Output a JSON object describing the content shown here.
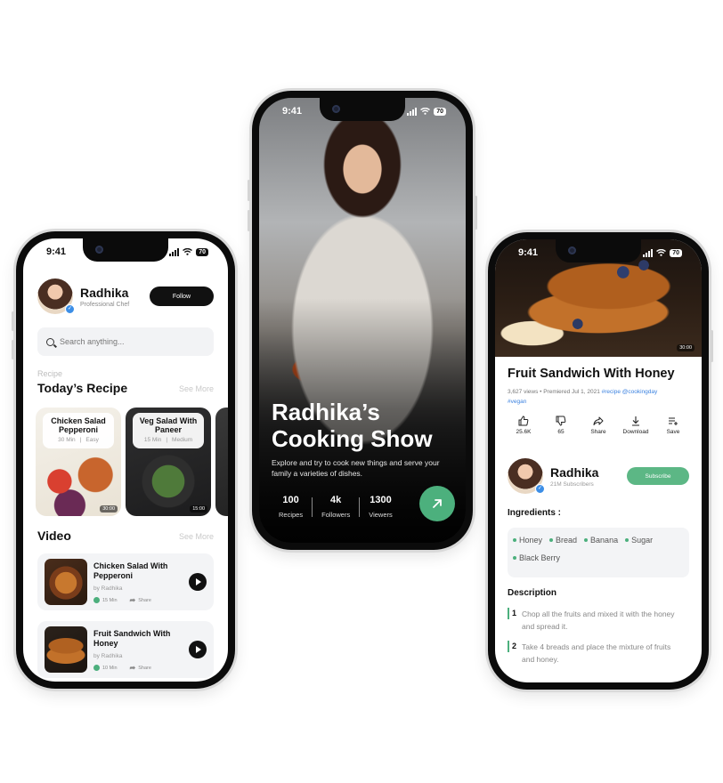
{
  "status": {
    "time": "9:41",
    "battery": "70"
  },
  "profile_screen": {
    "name": "Radhika",
    "role": "Professional Chef",
    "follow_label": "Follow",
    "search_placeholder": "Search anything...",
    "recipe_small_label": "Recipe",
    "recipes_title": "Today’s Recipe",
    "see_more": "See More",
    "recipes": [
      {
        "title": "Chicken Salad Pepperoni",
        "time": "30 Min",
        "level": "Easy",
        "duration": "30:00"
      },
      {
        "title": "Veg Salad With Paneer",
        "time": "15 Min",
        "level": "Medium",
        "duration": "15:00"
      }
    ],
    "video_title": "Video",
    "videos": [
      {
        "title": "Chicken Salad With Pepperoni",
        "by": "by Radhika",
        "time": "15 Min",
        "share": "Share"
      },
      {
        "title": "Fruit Sandwich With Honey",
        "by": "by Radhika",
        "time": "10 Min",
        "share": "Share"
      }
    ]
  },
  "show_screen": {
    "title_line1": "Radhika’s",
    "title_line2": "Cooking Show",
    "description": "Explore and try to cook new things and serve your family a varieties of dishes.",
    "stats": [
      {
        "value": "100",
        "label": "Recipes"
      },
      {
        "value": "4k",
        "label": "Followers"
      },
      {
        "value": "1300",
        "label": "Viewers"
      }
    ]
  },
  "detail_screen": {
    "video_duration": "30:00",
    "title": "Fruit Sandwich With Honey",
    "views_text": "3,627 views • Premiered Jul 1, 2021",
    "tags": "#recipe @cookingday",
    "tags2": "#vegan",
    "actions": [
      {
        "icon": "thumbs-up-icon",
        "label": "25.6K"
      },
      {
        "icon": "thumbs-down-icon",
        "label": "65"
      },
      {
        "icon": "share-icon",
        "label": "Share"
      },
      {
        "icon": "download-icon",
        "label": "Download"
      },
      {
        "icon": "save-icon",
        "label": "Save"
      }
    ],
    "channel_name": "Radhika",
    "subscribers": "21M Subscribers",
    "subscribe_label": "Subscribe",
    "ingredients_title": "Ingredients :",
    "ingredients": [
      "Honey",
      "Bread",
      "Banana",
      "Sugar",
      "Black Berry"
    ],
    "description_title": "Description",
    "steps": [
      {
        "num": "1",
        "text": "Chop all the fruits and mixed it with the honey and spread it."
      },
      {
        "num": "2",
        "text": "Take 4 breads and place the mixture of fruits and honey."
      }
    ]
  },
  "colors": {
    "accent": "#4cb07d",
    "link": "#3b82e0",
    "dark": "#111111"
  }
}
